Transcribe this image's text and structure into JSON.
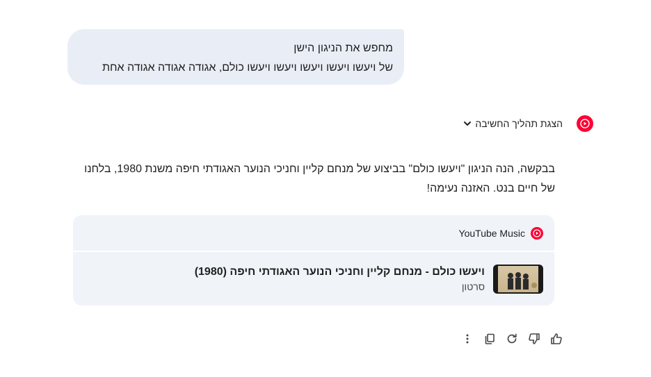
{
  "user_prompt": {
    "line1": "מחפש את הניגון הישן",
    "line2": "של ויעשו ויעשו ויעשו ויעשו ויעשו כולם, אגודה אגודה אגודה אחת"
  },
  "thinking": {
    "label": "הצגת תהליך החשיבה",
    "icon": "chevron-down-icon"
  },
  "response": {
    "text": "בבקשה, הנה הניגון \"ויעשו כולם\" בביצוע של מנחם קליין וחניכי הנוער האגודתי חיפה משנת 1980, בלחנו של חיים בנט. האזנה נעימה!"
  },
  "card": {
    "source": "YouTube Music",
    "item_title": "ויעשו כולם - מנחם קליין וחניכי הנוער האגודתי חיפה (1980)",
    "item_type": "סרטון"
  },
  "actions": [
    "thumbs-up-icon",
    "thumbs-down-icon",
    "refresh-icon",
    "copy-icon",
    "more-vert-icon"
  ],
  "colors": {
    "youtube_red": "#ff0033",
    "bubble_bg": "#e9eef6",
    "card_bg": "#f0f4f9",
    "text": "#1f1f1f"
  }
}
